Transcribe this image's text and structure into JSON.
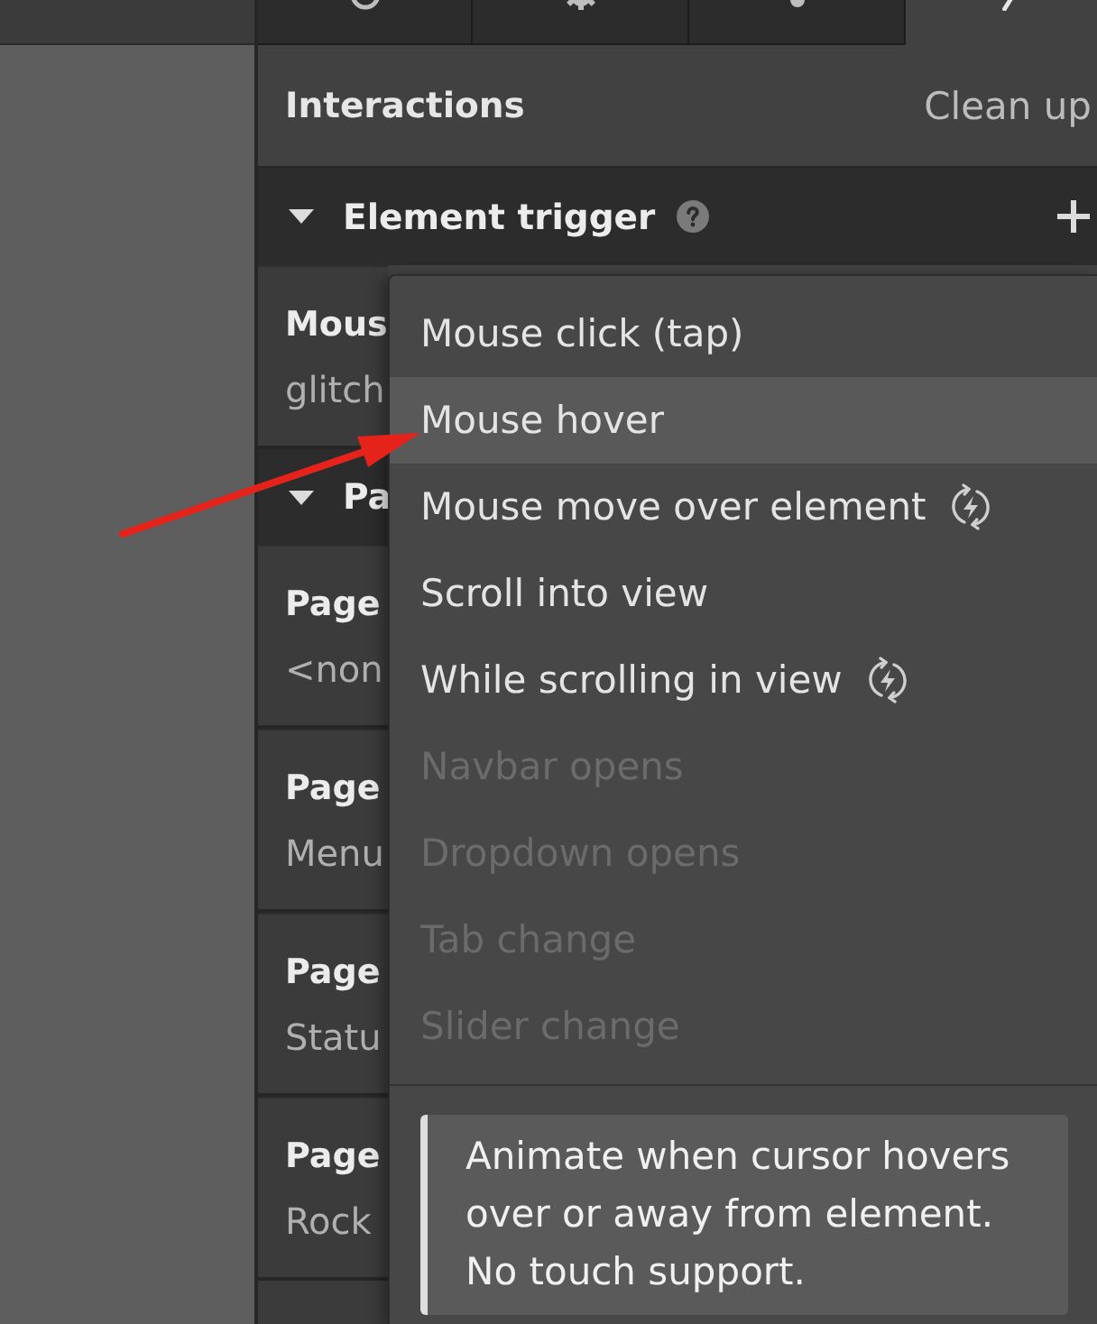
{
  "tabs": [
    {
      "selected": false
    },
    {
      "selected": false
    },
    {
      "selected": false
    },
    {
      "selected": true
    }
  ],
  "panel": {
    "title": "Interactions",
    "action": "Clean up"
  },
  "sections": [
    {
      "title": "Element trigger",
      "expanded": true,
      "items": [
        {
          "title": "Mous",
          "subtitle": "glitch"
        }
      ]
    },
    {
      "title": "Pa",
      "expanded": true,
      "items": [
        {
          "title": "Page",
          "subtitle": "<non"
        },
        {
          "title": "Page",
          "subtitle": "Menu"
        },
        {
          "title": "Page",
          "subtitle": "Statu"
        },
        {
          "title": "Page",
          "subtitle": "Rock"
        }
      ]
    }
  ],
  "trigger_menu": {
    "items": [
      {
        "label": "Mouse click (tap)",
        "kind": "plain",
        "selected": false,
        "disabled": false
      },
      {
        "label": "Mouse hover",
        "kind": "plain",
        "selected": true,
        "disabled": false
      },
      {
        "label": "Mouse move over element",
        "kind": "continuous",
        "selected": false,
        "disabled": false
      },
      {
        "label": "Scroll into view",
        "kind": "plain",
        "selected": false,
        "disabled": false
      },
      {
        "label": "While scrolling in view",
        "kind": "continuous",
        "selected": false,
        "disabled": false
      },
      {
        "label": "Navbar opens",
        "kind": "plain",
        "selected": false,
        "disabled": true
      },
      {
        "label": "Dropdown opens",
        "kind": "plain",
        "selected": false,
        "disabled": true
      },
      {
        "label": "Tab change",
        "kind": "plain",
        "selected": false,
        "disabled": true
      },
      {
        "label": "Slider change",
        "kind": "plain",
        "selected": false,
        "disabled": true
      }
    ],
    "description": "Animate when cursor hovers over or away from element. No touch support."
  }
}
